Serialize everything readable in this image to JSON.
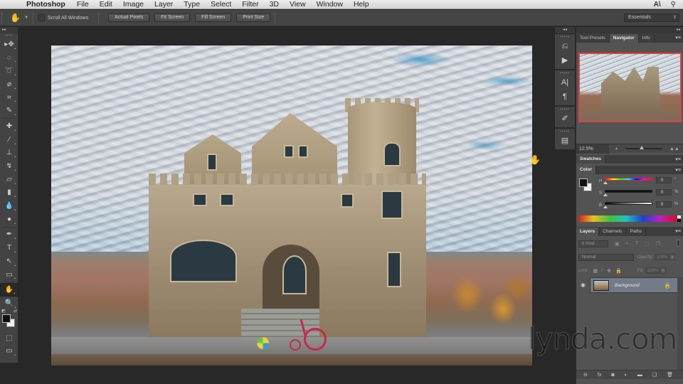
{
  "menubar": {
    "app_name": "Photoshop",
    "items": [
      "File",
      "Edit",
      "Image",
      "Layer",
      "Type",
      "Select",
      "Filter",
      "3D",
      "View",
      "Window",
      "Help"
    ],
    "apple_icon": "apple-logo",
    "right_icons": [
      "adobe-application-manager-icon",
      "spotlight-search-icon"
    ]
  },
  "options_bar": {
    "tool_icon": "hand-tool-icon",
    "scroll_all_windows_label": "Scroll All Windows",
    "scroll_all_windows_checked": false,
    "buttons": [
      "Actual Pixels",
      "Fit Screen",
      "Fill Screen",
      "Print Size"
    ],
    "workspace": "Essentials"
  },
  "toolbar": {
    "tools": [
      {
        "name": "move-tool",
        "glyph": "▸✥"
      },
      {
        "name": "rectangular-marquee-tool",
        "glyph": "◌"
      },
      {
        "name": "lasso-tool",
        "glyph": "➰"
      },
      {
        "name": "quick-selection-tool",
        "glyph": "⌀"
      },
      {
        "name": "crop-tool",
        "glyph": "⌗"
      },
      {
        "name": "eyedropper-tool",
        "glyph": "✎"
      },
      {
        "name": "spot-healing-brush-tool",
        "glyph": "✚"
      },
      {
        "name": "brush-tool",
        "glyph": "⁄"
      },
      {
        "name": "clone-stamp-tool",
        "glyph": "⊥"
      },
      {
        "name": "history-brush-tool",
        "glyph": "↯"
      },
      {
        "name": "eraser-tool",
        "glyph": "▱"
      },
      {
        "name": "gradient-tool",
        "glyph": "▮"
      },
      {
        "name": "blur-tool",
        "glyph": "💧"
      },
      {
        "name": "dodge-tool",
        "glyph": "●"
      },
      {
        "name": "pen-tool",
        "glyph": "✒"
      },
      {
        "name": "type-tool",
        "glyph": "T"
      },
      {
        "name": "path-selection-tool",
        "glyph": "↖"
      },
      {
        "name": "rectangle-tool",
        "glyph": "▭"
      },
      {
        "name": "hand-tool",
        "glyph": "✋",
        "active": true
      },
      {
        "name": "zoom-tool",
        "glyph": "🔍"
      }
    ],
    "foreground_color": "#111111",
    "background_color": "#f0f0f0"
  },
  "canvas": {
    "image_description": "Stone castle-style mansion with round tower under a cloudy blue sky, autumn landscape, ball and red tricycle on the sidewalk",
    "cursor": "hand-cursor"
  },
  "watermark": "lynda.com",
  "dock": {
    "groups": [
      [
        "history-icon",
        "actions-play-icon"
      ],
      [
        "character-icon",
        "paragraph-icon"
      ],
      [
        "brush-presets-icon"
      ],
      [
        "properties-icon"
      ]
    ],
    "glyphs": {
      "history-icon": "⎌",
      "actions-play-icon": "▶",
      "character-icon": "A|",
      "paragraph-icon": "¶",
      "brush-presets-icon": "✐",
      "properties-icon": "▤"
    }
  },
  "navigator_panel": {
    "tabs": [
      "Tool Presets",
      "Navigator",
      "Info"
    ],
    "active_tab": "Navigator",
    "zoom_level": "12.5%",
    "zoom_slider_fraction": 0.45,
    "view_box_color": "#e04040"
  },
  "swatches_panel": {
    "tabs": [
      "Swatches"
    ]
  },
  "color_panel": {
    "tabs": [
      "Color"
    ],
    "foreground": "#111111",
    "background": "#f0f0f0",
    "sliders": [
      {
        "label": "H",
        "value": "0",
        "unit": "°"
      },
      {
        "label": "S",
        "value": "0",
        "unit": "%"
      },
      {
        "label": "B",
        "value": "0",
        "unit": "%"
      }
    ]
  },
  "layers_panel": {
    "tabs": [
      "Layers",
      "Channels",
      "Paths"
    ],
    "active_tab": "Layers",
    "filter_kind": "Kind",
    "blend_mode": "Normal",
    "opacity_label": "Opacity:",
    "opacity_value": "100%",
    "lock_label": "Lock:",
    "fill_label": "Fill:",
    "fill_value": "100%",
    "layers": [
      {
        "name": "Background",
        "visible": true,
        "locked": true,
        "selected": true
      }
    ],
    "footer_icons": [
      "link-layers-icon",
      "layer-style-fx-icon",
      "add-mask-icon",
      "adjustment-layer-icon",
      "new-group-icon",
      "new-layer-icon",
      "delete-layer-icon"
    ],
    "footer_glyphs": [
      "⊖",
      "fx",
      "◙",
      "◐",
      "▬",
      "❏",
      "🗑"
    ]
  }
}
